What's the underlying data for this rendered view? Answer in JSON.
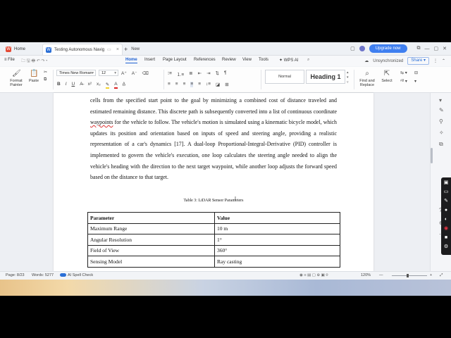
{
  "tabs": {
    "home_tab": "Home",
    "doc_tab": "Testing Autonomous Navig",
    "new_tab": "New"
  },
  "titlebar": {
    "upgrade": "Upgrade now"
  },
  "menubar": {
    "file": "File",
    "items": [
      "Home",
      "Insert",
      "Page Layout",
      "References",
      "Review",
      "View",
      "Tools"
    ],
    "wps_ai": "WPS AI",
    "sync": "Unsynchronized",
    "share": "Share"
  },
  "ribbon": {
    "format_painter": "Format Painter",
    "paste": "Paste",
    "font_name": "Times New Roman",
    "font_size": "12",
    "style_normal": "Normal",
    "style_heading": "Heading 1",
    "find_replace": "Find and Replace",
    "select": "Select"
  },
  "document": {
    "para_before": "cells from the specified start point to the goal by minimizing a combined cost of distance traveled and estimated remaining distance. This discrete path is subsequently converted into a list of continuous coordinate ",
    "para_underlined": "waypoints",
    "para_after": " for the vehicle to follow. The vehicle's motion is simulated using a kinematic bicycle model, which updates its position and orientation based on inputs of speed and steering angle, providing a realistic representation of a car's dynamics [17]. A dual-loop Proportional-Integral-Derivative (PID) controller is implemented to govern the vehicle's execution, one loop calculates the steering angle needed to align the vehicle's heading with the direction to the next target waypoint, while another loop adjusts the forward speed based on the distance to that target.",
    "table_caption": "Table 3: LiDAR Sensor Parameters",
    "table_headers": [
      "Parameter",
      "Value"
    ],
    "table_rows": [
      [
        "Maximum Range",
        "10 m"
      ],
      [
        "Angular Resolution",
        "1°"
      ],
      [
        "Field of View",
        "360°"
      ],
      [
        "Sensing Model",
        "Ray casting"
      ]
    ]
  },
  "status": {
    "page": "Page: 8/23",
    "words": "Words: 5277",
    "spell": "AI Spell Check",
    "zoom": "120%"
  }
}
